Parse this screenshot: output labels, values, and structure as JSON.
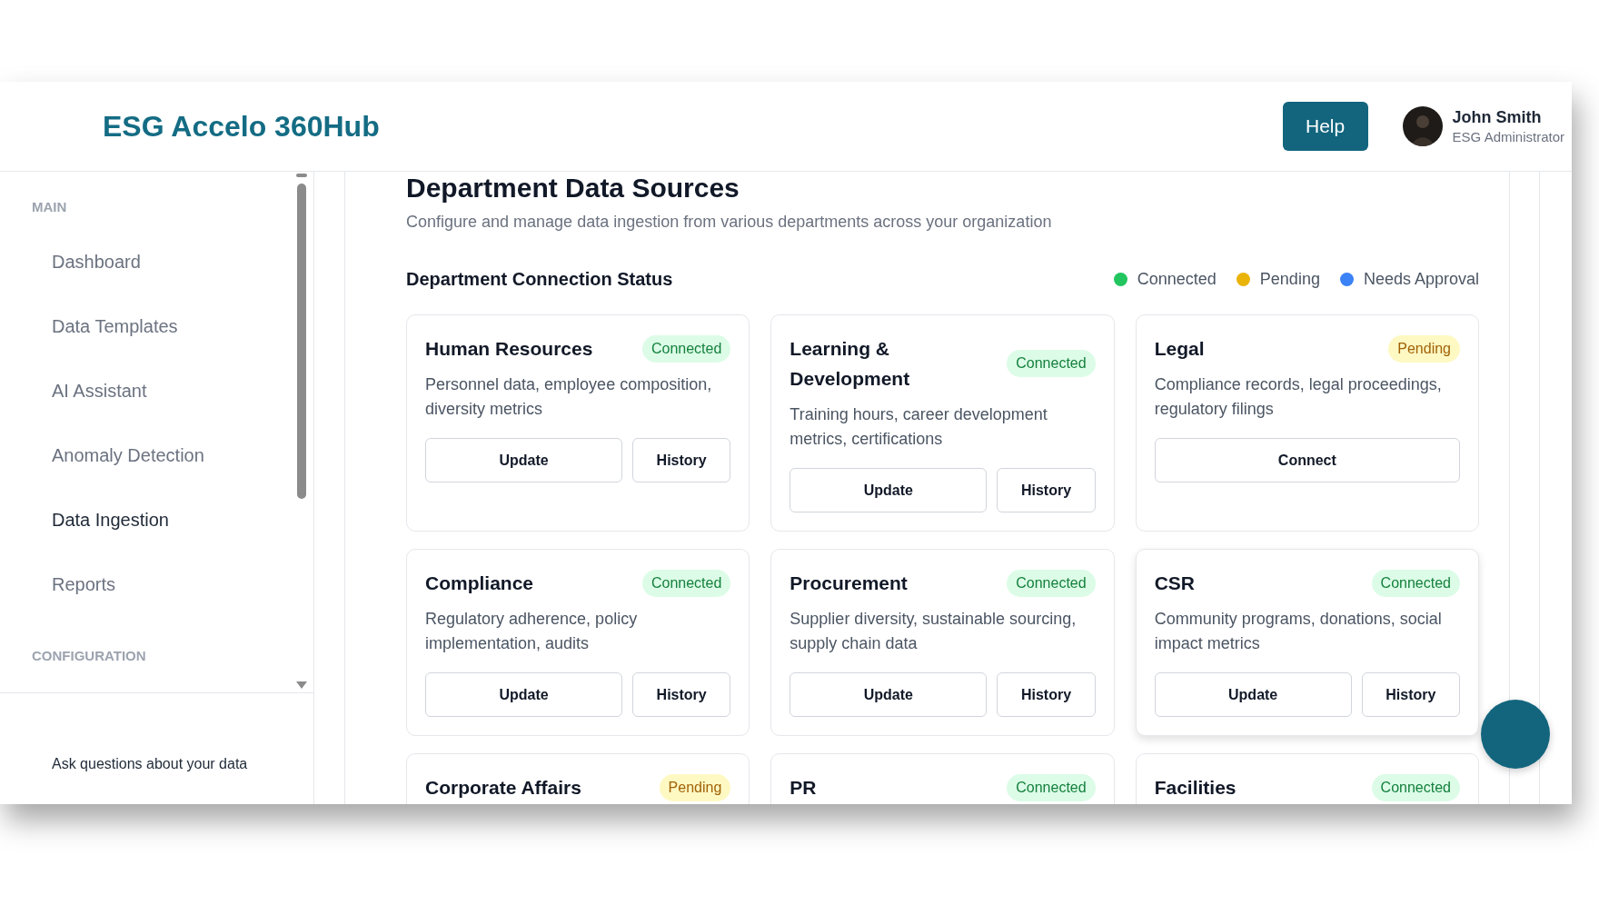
{
  "header": {
    "title": "ESG Accelo 360Hub",
    "help_button": "Help",
    "user": {
      "name": "John Smith",
      "role": "ESG Administrator"
    }
  },
  "sidebar": {
    "sections": [
      {
        "heading": "MAIN",
        "items": [
          {
            "label": "Dashboard",
            "selected": false
          },
          {
            "label": "Data Templates",
            "selected": false
          },
          {
            "label": "AI Assistant",
            "selected": false
          },
          {
            "label": "Anomaly Detection",
            "selected": false
          },
          {
            "label": "Data Ingestion",
            "selected": true
          },
          {
            "label": "Reports",
            "selected": false
          }
        ]
      },
      {
        "heading": "CONFIGURATION"
      }
    ],
    "footer_text": "Ask questions about your data"
  },
  "page": {
    "title": "Department Data Sources",
    "subtitle": "Configure and manage data ingestion from various departments across your organization",
    "section_title": "Department Connection Status",
    "legend": [
      {
        "label": "Connected",
        "color": "#22c55e"
      },
      {
        "label": "Pending",
        "color": "#eab308"
      },
      {
        "label": "Needs Approval",
        "color": "#3b82f6"
      }
    ],
    "departments": [
      {
        "name": "Human Resources",
        "status": {
          "label": "Connected",
          "kind": "connected"
        },
        "description": "Personnel data, employee composition, diversity metrics",
        "actions": [
          "Update",
          "History"
        ]
      },
      {
        "name": "Learning & Development",
        "status": {
          "label": "Connected",
          "kind": "connected"
        },
        "description": "Training hours, career development metrics, certifications",
        "actions": [
          "Update",
          "History"
        ]
      },
      {
        "name": "Legal",
        "status": {
          "label": "Pending",
          "kind": "pending"
        },
        "description": "Compliance records, legal proceedings, regulatory filings",
        "actions": [
          "Connect"
        ]
      },
      {
        "name": "Compliance",
        "status": {
          "label": "Connected",
          "kind": "connected"
        },
        "description": "Regulatory adherence, policy implementation, audits",
        "actions": [
          "Update",
          "History"
        ]
      },
      {
        "name": "Procurement",
        "status": {
          "label": "Connected",
          "kind": "connected"
        },
        "description": "Supplier diversity, sustainable sourcing, supply chain data",
        "actions": [
          "Update",
          "History"
        ]
      },
      {
        "name": "CSR",
        "status": {
          "label": "Connected",
          "kind": "connected"
        },
        "description": "Community programs, donations, social impact metrics",
        "actions": [
          "Update",
          "History"
        ]
      },
      {
        "name": "Corporate Affairs",
        "status": {
          "label": "Pending",
          "kind": "pending"
        }
      },
      {
        "name": "PR",
        "status": {
          "label": "Connected",
          "kind": "connected"
        }
      },
      {
        "name": "Facilities",
        "status": {
          "label": "Connected",
          "kind": "connected"
        }
      }
    ]
  }
}
